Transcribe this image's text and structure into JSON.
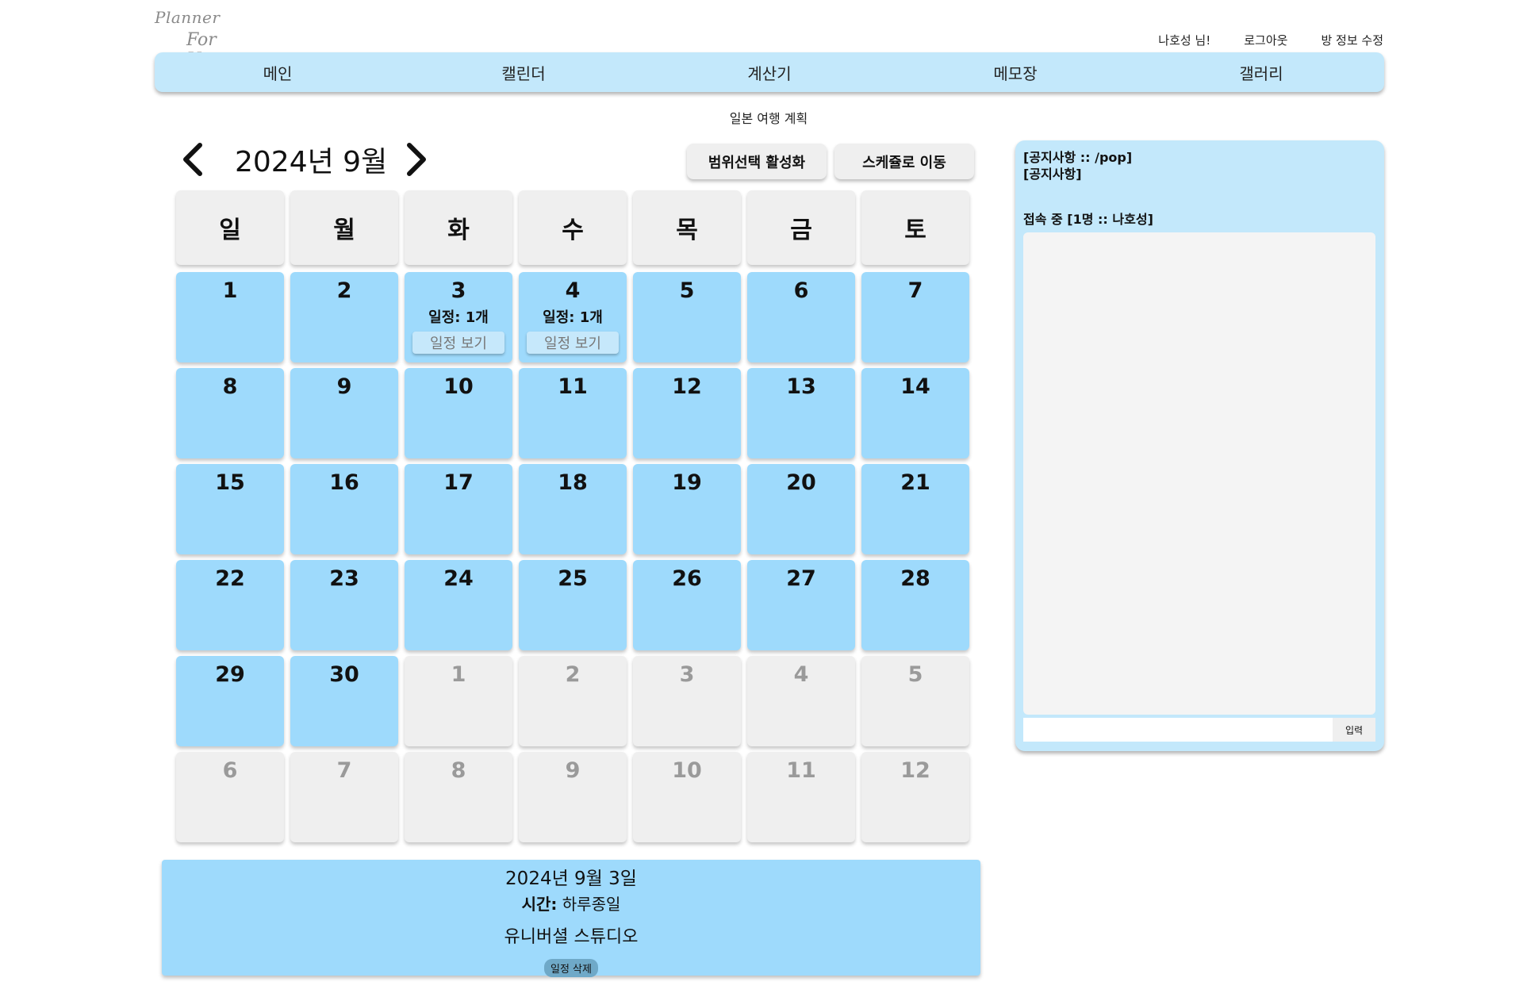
{
  "logo": {
    "line1": "Planner",
    "line2": "For U"
  },
  "user": {
    "greeting": "나호성 님!",
    "logout": "로그아웃",
    "edit_room": "방 정보 수정"
  },
  "nav": [
    "메인",
    "캘린더",
    "계산기",
    "메모장",
    "갤러리"
  ],
  "plan_title": "일본 여행 계획",
  "calendar": {
    "month_title": "2024년 9월",
    "buttons": {
      "range": "범위선택 활성화",
      "schedule": "스케쥴로 이동"
    },
    "weekdays": [
      "일",
      "월",
      "화",
      "수",
      "목",
      "금",
      "토"
    ],
    "weeks": [
      [
        {
          "day": "1",
          "current": true
        },
        {
          "day": "2",
          "current": true
        },
        {
          "day": "3",
          "current": true,
          "count": "일정: 1개",
          "view": "일정 보기"
        },
        {
          "day": "4",
          "current": true,
          "count": "일정: 1개",
          "view": "일정 보기"
        },
        {
          "day": "5",
          "current": true
        },
        {
          "day": "6",
          "current": true
        },
        {
          "day": "7",
          "current": true
        }
      ],
      [
        {
          "day": "8",
          "current": true
        },
        {
          "day": "9",
          "current": true
        },
        {
          "day": "10",
          "current": true
        },
        {
          "day": "11",
          "current": true
        },
        {
          "day": "12",
          "current": true
        },
        {
          "day": "13",
          "current": true
        },
        {
          "day": "14",
          "current": true
        }
      ],
      [
        {
          "day": "15",
          "current": true
        },
        {
          "day": "16",
          "current": true
        },
        {
          "day": "17",
          "current": true
        },
        {
          "day": "18",
          "current": true
        },
        {
          "day": "19",
          "current": true
        },
        {
          "day": "20",
          "current": true
        },
        {
          "day": "21",
          "current": true
        }
      ],
      [
        {
          "day": "22",
          "current": true
        },
        {
          "day": "23",
          "current": true
        },
        {
          "day": "24",
          "current": true
        },
        {
          "day": "25",
          "current": true
        },
        {
          "day": "26",
          "current": true
        },
        {
          "day": "27",
          "current": true
        },
        {
          "day": "28",
          "current": true
        }
      ],
      [
        {
          "day": "29",
          "current": true
        },
        {
          "day": "30",
          "current": true
        },
        {
          "day": "1",
          "current": false
        },
        {
          "day": "2",
          "current": false
        },
        {
          "day": "3",
          "current": false
        },
        {
          "day": "4",
          "current": false
        },
        {
          "day": "5",
          "current": false
        }
      ],
      [
        {
          "day": "6",
          "current": false
        },
        {
          "day": "7",
          "current": false
        },
        {
          "day": "8",
          "current": false
        },
        {
          "day": "9",
          "current": false
        },
        {
          "day": "10",
          "current": false
        },
        {
          "day": "11",
          "current": false
        },
        {
          "day": "12",
          "current": false
        }
      ]
    ]
  },
  "detail": {
    "date": "2024년 9월 3일",
    "time_label": "시간:",
    "time_value": "하루종일",
    "title": "유니버셜 스튜디오",
    "delete": "일정 삭제"
  },
  "side": {
    "notice_title": "[공지사항 :: /pop]",
    "notice_body": "[공지사항]",
    "online": "접속 중 [1명 :: 나호성]",
    "input_value": "",
    "send": "입력"
  },
  "colors": {
    "nav_bg": "#c3e8fb",
    "current_day": "#9edafc",
    "other_day": "#efefef",
    "delete_button": "#6fa9c8"
  },
  "icons": {
    "prev": "chevron-left-icon",
    "next": "chevron-right-icon"
  }
}
